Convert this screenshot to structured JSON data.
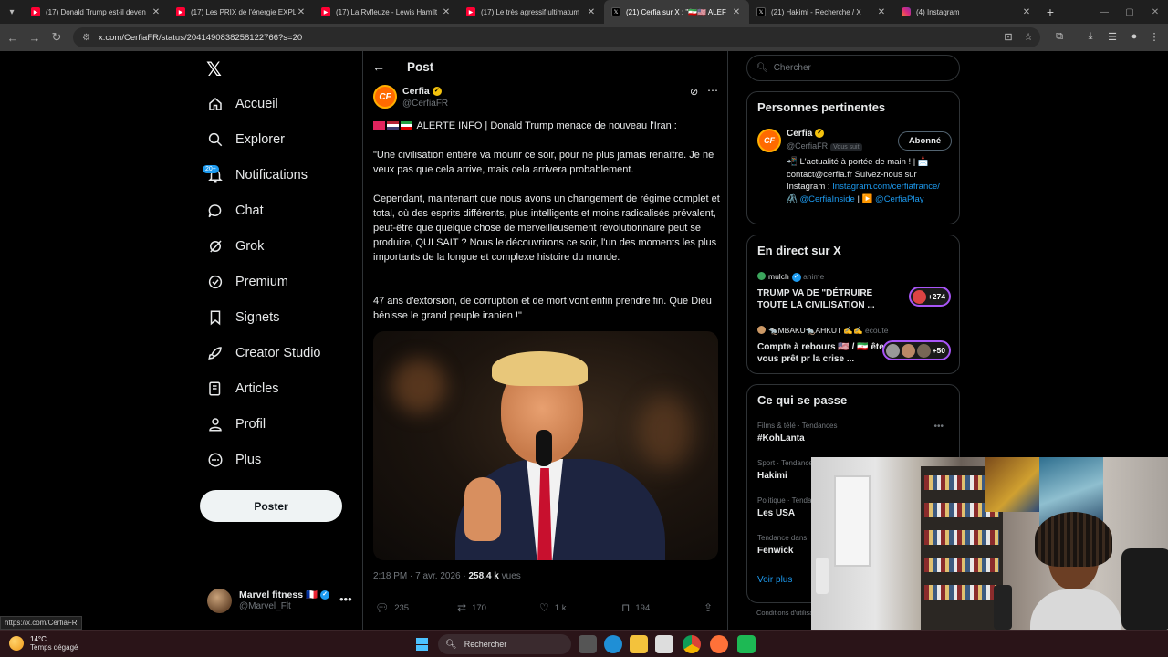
{
  "browser": {
    "tabs": [
      {
        "label": "(17) Donald Trump est-il deven",
        "icon": "youtube-icon"
      },
      {
        "label": "(17) Les PRIX de l'énergie EXPL",
        "icon": "youtube-icon"
      },
      {
        "label": "(17) La Rvfleuze - Lewis Hamilt",
        "icon": "youtube-icon"
      },
      {
        "label": "(17) Le très agressif ultimatum",
        "icon": "youtube-icon"
      },
      {
        "label": "(21) Cerfia sur X : \"🇮🇷🇺🇸 ALEF",
        "icon": "x-icon",
        "active": true
      },
      {
        "label": "(21) Hakimi - Recherche / X",
        "icon": "x-icon"
      },
      {
        "label": "(4) Instagram",
        "icon": "instagram-icon"
      }
    ],
    "url": "x.com/CerfiaFR/status/2041490838258122766?s=20",
    "status_url": "https://x.com/CerfiaFR"
  },
  "nav": {
    "items": [
      {
        "label": "Accueil",
        "icon": "home-icon"
      },
      {
        "label": "Explorer",
        "icon": "search-icon"
      },
      {
        "label": "Notifications",
        "icon": "bell-icon"
      },
      {
        "label": "Chat",
        "icon": "chat-icon"
      },
      {
        "label": "Grok",
        "icon": "grok-icon"
      },
      {
        "label": "Premium",
        "icon": "premium-icon"
      },
      {
        "label": "Signets",
        "icon": "bookmark-icon"
      },
      {
        "label": "Creator Studio",
        "icon": "rocket-icon"
      },
      {
        "label": "Articles",
        "icon": "articles-icon"
      },
      {
        "label": "Profil",
        "icon": "profile-icon"
      },
      {
        "label": "Plus",
        "icon": "more-circle-icon"
      }
    ],
    "notifications_badge": "20+",
    "post_button": "Poster",
    "account": {
      "name": "Marvel fitness 🇫🇷",
      "handle": "@Marvel_Flt"
    }
  },
  "main": {
    "title": "Post",
    "post": {
      "author": "Cerfia",
      "handle": "@CerfiaFR",
      "avatar_text": "CF",
      "headline": "ALERTE INFO | Donald Trump menace de nouveau l'Iran :",
      "para1": "\"Une civilisation entière va mourir ce soir, pour ne plus jamais renaître. Je ne veux pas que cela arrive, mais cela arrivera probablement.",
      "para2": "Cependant, maintenant que nous avons un changement de régime complet et total, où des esprits différents, plus intelligents et moins radicalisés prévalent, peut-être que quelque chose de merveilleusement révolutionnaire peut se produire, QUI SAIT ? Nous le découvrirons ce soir, l'un des moments les plus importants de la longue et complexe histoire du monde.",
      "para3": "47 ans d'extorsion, de corruption et de mort vont enfin prendre fin. Que Dieu bénisse le grand peuple iranien !\"",
      "time": "2:18 PM · 7 avr. 2026 ·",
      "views": "258,4 k",
      "views_label": "vues",
      "replies": "235",
      "reposts": "170",
      "likes": "1 k",
      "bookmarks": "194"
    }
  },
  "right": {
    "search_placeholder": "Chercher",
    "relevant": {
      "title": "Personnes pertinentes",
      "name": "Cerfia",
      "handle": "@CerfiaFR",
      "follows_you": "Vous suit",
      "button": "Abonné",
      "bio_1": "📲 L'actualité à portée de main ! | 📩 contact@cerfia.fr Suivez-nous sur Instagram :",
      "bio_link1": "Instagram.com/cerfiafrance/",
      "bio_2": "🖇️",
      "bio_link2": "@CerfiaInside",
      "bio_3": "| ▶️",
      "bio_link3": "@CerfiaPlay"
    },
    "live": {
      "title": "En direct sur X",
      "items": [
        {
          "host": "mulch",
          "status": "anime",
          "title": "TRUMP VA DE \"DÉTRUIRE TOUTE LA CIVILISATION ...",
          "count": "+274"
        },
        {
          "host": "🐀MBAKU🐀AHKUT ✍️✍️",
          "status": "écoute",
          "title": "Compte à rebours 🇺🇸 / 🇮🇷 êtes vous prêt pr la crise ...",
          "count": "+50"
        }
      ]
    },
    "happening": {
      "title": "Ce qui se passe",
      "items": [
        {
          "meta": "Films & télé · Tendances",
          "title": "#KohLanta"
        },
        {
          "meta": "Sport · Tendances",
          "title": "Hakimi"
        },
        {
          "meta": "Politique · Tendances",
          "title": "Les USA"
        },
        {
          "meta": "Tendance dans",
          "title": "Fenwick"
        }
      ],
      "see_more": "Voir plus"
    },
    "footer": "Conditions d'utilisation"
  },
  "taskbar": {
    "temp": "14°C",
    "weather": "Temps dégagé",
    "search": "Rechercher"
  }
}
